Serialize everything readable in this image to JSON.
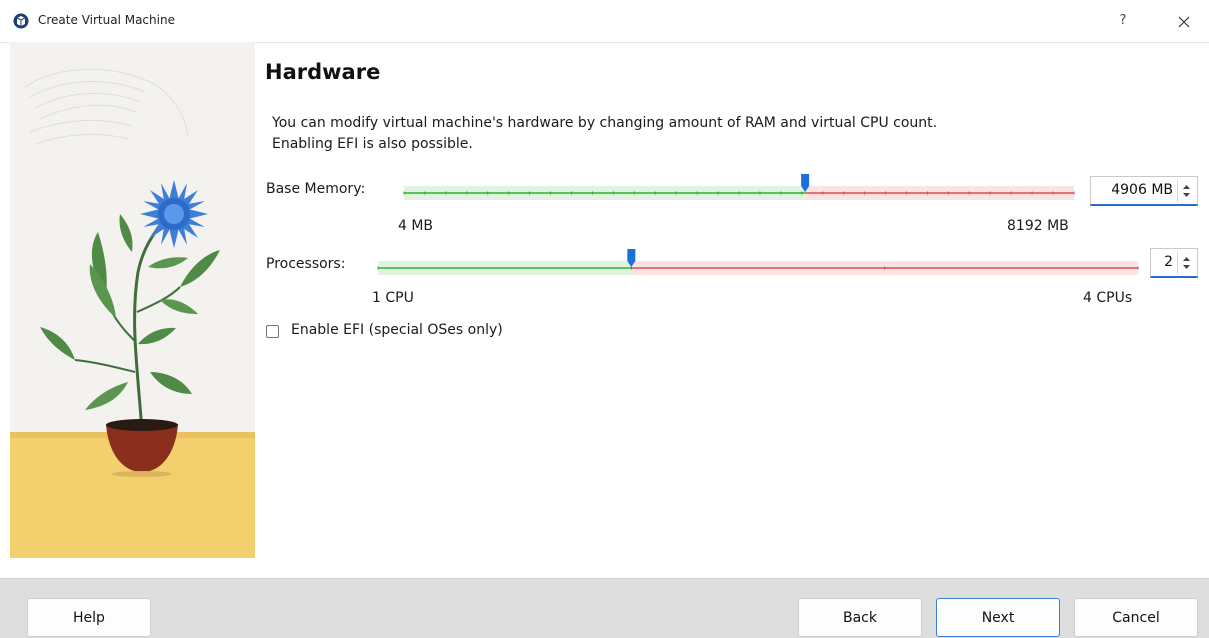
{
  "window": {
    "title": "Create Virtual Machine",
    "help_label": "?",
    "close_icon": "close-icon"
  },
  "page": {
    "title": "Hardware",
    "description_line1": "You can modify virtual machine's hardware by changing amount of RAM and virtual CPU count.",
    "description_line2": "Enabling EFI is also possible."
  },
  "memory": {
    "label": "Base Memory:",
    "min_label": "4 MB",
    "max_label": "8192 MB",
    "min": 4,
    "max": 8192,
    "value": 4906,
    "recommended_max": 4915,
    "value_text": "4906 MB"
  },
  "processors": {
    "label": "Processors:",
    "min_label": "1 CPU",
    "max_label": "4 CPUs",
    "min": 1,
    "max": 4,
    "value": 2,
    "recommended_max": 2,
    "value_text": "2"
  },
  "efi": {
    "label": "Enable EFI (special OSes only)",
    "checked": false
  },
  "buttons": {
    "help": "Help",
    "back": "Back",
    "next": "Next",
    "cancel": "Cancel"
  },
  "colors": {
    "accent": "#1e6fd9",
    "ok_track": "#5cc35c",
    "warn_track": "#e57373",
    "ok_fill": "#dff3df",
    "warn_fill": "#fbe3e3"
  }
}
